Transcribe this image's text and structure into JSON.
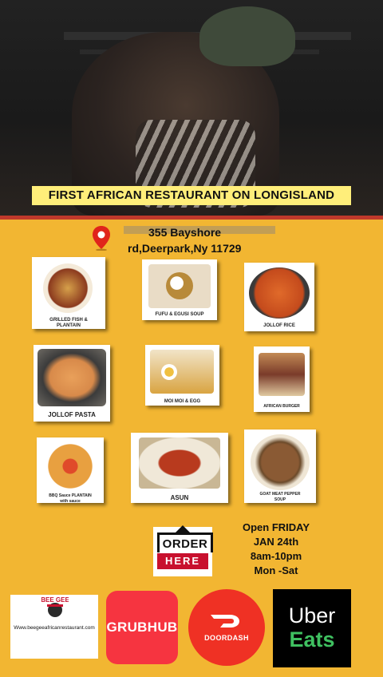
{
  "headline": "FIRST AFRICAN RESTAURANT ON LONGISLAND",
  "address": {
    "line1": "355 Bayshore",
    "line2": "rd,Deerpark,Ny 11729"
  },
  "menu": [
    {
      "name": "GRILLED FISH & PLANTAIN",
      "color": "#8b3a1e"
    },
    {
      "name": "FUFU & EGUSI SOUP",
      "color": "#c9a46a"
    },
    {
      "name": "JOLLOF RICE",
      "color": "#c44a1c"
    },
    {
      "name": "JOLLOF PASTA",
      "color": "#d88a4a"
    },
    {
      "name": "MOI MOI & EGG",
      "color": "#d9a441"
    },
    {
      "name": "AFRICAN BURGER",
      "color": "#7a3b2a"
    },
    {
      "name": "BBQ Sauce PLANTAIN with sauce",
      "color": "#d9641c"
    },
    {
      "name": "ASUN",
      "color": "#9a2a14"
    },
    {
      "name": "GOAT MEAT PEPPER SOUP",
      "color": "#6b4a2a"
    }
  ],
  "order": {
    "line1": "ORDER",
    "line2": "HERE"
  },
  "hours": {
    "l1": "Open FRIDAY",
    "l2": "JAN 24th",
    "l3": "8am-10pm",
    "l4": "Mon -Sat"
  },
  "logos": {
    "beegee_brand": "BEE GEE",
    "beegee_url": "Www.beegeeafricanrestaurant.com",
    "grubhub": "GRUBHUB",
    "doordash": "DOORDASH",
    "uber": "Uber",
    "eats": "Eats"
  }
}
